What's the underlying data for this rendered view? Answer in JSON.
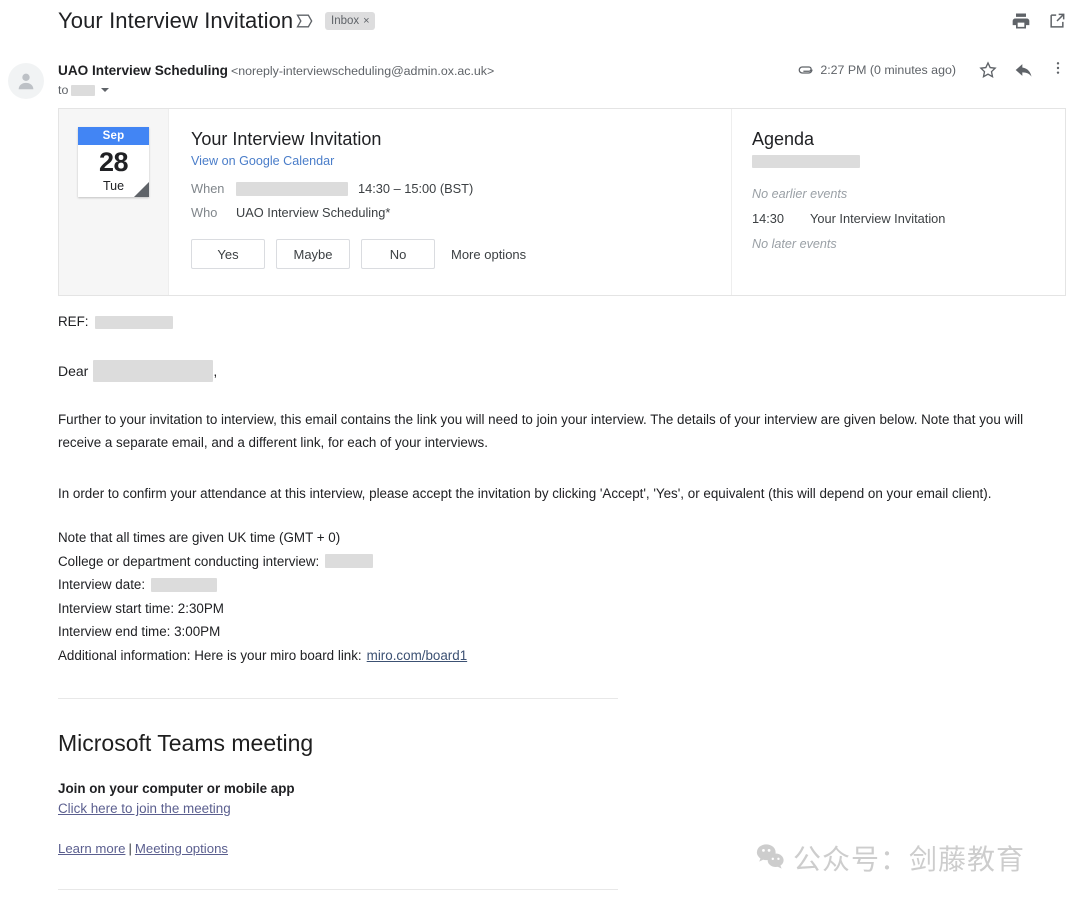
{
  "header": {
    "subject": "Your Interview Invitation",
    "label_chip": "Inbox",
    "label_chip_close": "×",
    "print_icon": "print-icon",
    "popout_icon": "open-in-new-window-icon"
  },
  "sender": {
    "name": "UAO Interview Scheduling",
    "email": "<noreply-interviewscheduling@admin.ox.ac.uk>",
    "to_label": "to",
    "to_value_redacted": true,
    "timestamp": "2:27 PM (0 minutes ago)",
    "attachment_icon": "paperclip-icon",
    "star_icon": "star-icon",
    "reply_icon": "reply-icon",
    "more_icon": "more-vertical-icon"
  },
  "invite": {
    "date_chip": {
      "month": "Sep",
      "day": "28",
      "weekday": "Tue",
      "month_bg": "#4285f4"
    },
    "title": "Your Interview Invitation",
    "calendar_link": "View on Google Calendar",
    "when_label": "When",
    "when_value": "14:30 – 15:00 (BST)",
    "who_label": "Who",
    "who_value": "UAO Interview Scheduling*",
    "rsvp": [
      "Yes",
      "Maybe",
      "No"
    ],
    "more_options": "More options"
  },
  "agenda": {
    "title": "Agenda",
    "no_earlier": "No earlier events",
    "event_time": "14:30",
    "event_title": "Your Interview Invitation",
    "no_later": "No later events"
  },
  "body": {
    "ref_label": "REF:",
    "dear_label": "Dear",
    "dear_comma": ",",
    "paragraph1": "Further to your invitation to interview, this email contains the link you will need to join your interview. The details of your interview are given below. Note that you will receive a separate email, and a different link, for each of your interviews.",
    "paragraph2": "In order to confirm your attendance at this interview, please accept the invitation by clicking 'Accept', 'Yes', or equivalent (this will depend on your email client).",
    "detail_uk_time": "Note that all times are given UK time (GMT + 0)",
    "detail_college_label": "College or department conducting interview:",
    "detail_date_label": "Interview date:",
    "detail_start": "Interview start time: 2:30PM",
    "detail_end": "Interview end time: 3:00PM",
    "detail_additional_label": "Additional information: Here is your miro board link:",
    "detail_additional_link": "miro.com/board1"
  },
  "teams": {
    "title": "Microsoft Teams meeting",
    "join_label": "Join on your computer or mobile app",
    "join_link": "Click here to join the meeting",
    "learn_more": "Learn more",
    "separator": "|",
    "meeting_options": "Meeting options"
  },
  "watermark": {
    "icon": "wechat-icon",
    "text": "公众号：剑藤教育"
  },
  "colors": {
    "accent_blue": "#4285f4",
    "link_blue": "#4a7dc9",
    "link_slate": "#5b5f8f",
    "muted": "#5f6368",
    "redaction": "#dcdcdc"
  }
}
